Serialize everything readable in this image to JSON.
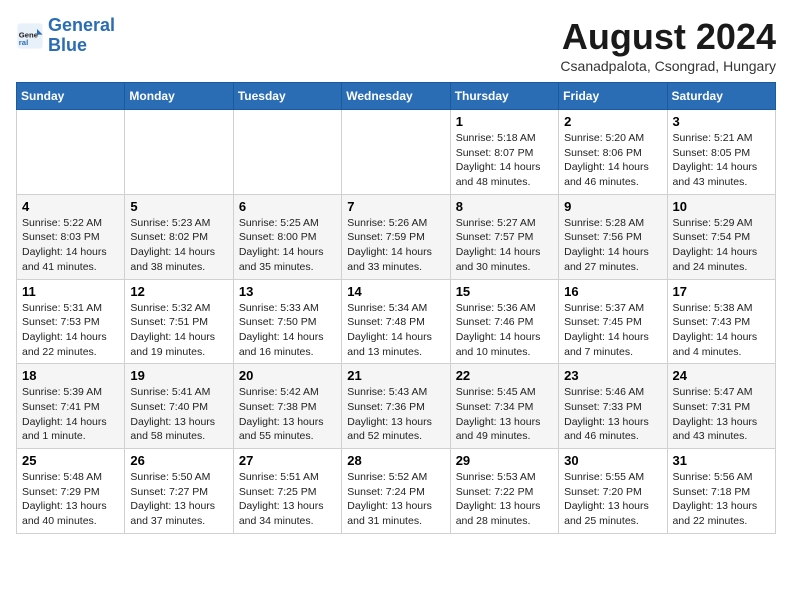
{
  "logo": {
    "line1": "General",
    "line2": "Blue"
  },
  "title": "August 2024",
  "subtitle": "Csanadpalota, Csongrad, Hungary",
  "days_of_week": [
    "Sunday",
    "Monday",
    "Tuesday",
    "Wednesday",
    "Thursday",
    "Friday",
    "Saturday"
  ],
  "weeks": [
    [
      {
        "day": "",
        "info": ""
      },
      {
        "day": "",
        "info": ""
      },
      {
        "day": "",
        "info": ""
      },
      {
        "day": "",
        "info": ""
      },
      {
        "day": "1",
        "info": "Sunrise: 5:18 AM\nSunset: 8:07 PM\nDaylight: 14 hours and 48 minutes."
      },
      {
        "day": "2",
        "info": "Sunrise: 5:20 AM\nSunset: 8:06 PM\nDaylight: 14 hours and 46 minutes."
      },
      {
        "day": "3",
        "info": "Sunrise: 5:21 AM\nSunset: 8:05 PM\nDaylight: 14 hours and 43 minutes."
      }
    ],
    [
      {
        "day": "4",
        "info": "Sunrise: 5:22 AM\nSunset: 8:03 PM\nDaylight: 14 hours and 41 minutes."
      },
      {
        "day": "5",
        "info": "Sunrise: 5:23 AM\nSunset: 8:02 PM\nDaylight: 14 hours and 38 minutes."
      },
      {
        "day": "6",
        "info": "Sunrise: 5:25 AM\nSunset: 8:00 PM\nDaylight: 14 hours and 35 minutes."
      },
      {
        "day": "7",
        "info": "Sunrise: 5:26 AM\nSunset: 7:59 PM\nDaylight: 14 hours and 33 minutes."
      },
      {
        "day": "8",
        "info": "Sunrise: 5:27 AM\nSunset: 7:57 PM\nDaylight: 14 hours and 30 minutes."
      },
      {
        "day": "9",
        "info": "Sunrise: 5:28 AM\nSunset: 7:56 PM\nDaylight: 14 hours and 27 minutes."
      },
      {
        "day": "10",
        "info": "Sunrise: 5:29 AM\nSunset: 7:54 PM\nDaylight: 14 hours and 24 minutes."
      }
    ],
    [
      {
        "day": "11",
        "info": "Sunrise: 5:31 AM\nSunset: 7:53 PM\nDaylight: 14 hours and 22 minutes."
      },
      {
        "day": "12",
        "info": "Sunrise: 5:32 AM\nSunset: 7:51 PM\nDaylight: 14 hours and 19 minutes."
      },
      {
        "day": "13",
        "info": "Sunrise: 5:33 AM\nSunset: 7:50 PM\nDaylight: 14 hours and 16 minutes."
      },
      {
        "day": "14",
        "info": "Sunrise: 5:34 AM\nSunset: 7:48 PM\nDaylight: 14 hours and 13 minutes."
      },
      {
        "day": "15",
        "info": "Sunrise: 5:36 AM\nSunset: 7:46 PM\nDaylight: 14 hours and 10 minutes."
      },
      {
        "day": "16",
        "info": "Sunrise: 5:37 AM\nSunset: 7:45 PM\nDaylight: 14 hours and 7 minutes."
      },
      {
        "day": "17",
        "info": "Sunrise: 5:38 AM\nSunset: 7:43 PM\nDaylight: 14 hours and 4 minutes."
      }
    ],
    [
      {
        "day": "18",
        "info": "Sunrise: 5:39 AM\nSunset: 7:41 PM\nDaylight: 14 hours and 1 minute."
      },
      {
        "day": "19",
        "info": "Sunrise: 5:41 AM\nSunset: 7:40 PM\nDaylight: 13 hours and 58 minutes."
      },
      {
        "day": "20",
        "info": "Sunrise: 5:42 AM\nSunset: 7:38 PM\nDaylight: 13 hours and 55 minutes."
      },
      {
        "day": "21",
        "info": "Sunrise: 5:43 AM\nSunset: 7:36 PM\nDaylight: 13 hours and 52 minutes."
      },
      {
        "day": "22",
        "info": "Sunrise: 5:45 AM\nSunset: 7:34 PM\nDaylight: 13 hours and 49 minutes."
      },
      {
        "day": "23",
        "info": "Sunrise: 5:46 AM\nSunset: 7:33 PM\nDaylight: 13 hours and 46 minutes."
      },
      {
        "day": "24",
        "info": "Sunrise: 5:47 AM\nSunset: 7:31 PM\nDaylight: 13 hours and 43 minutes."
      }
    ],
    [
      {
        "day": "25",
        "info": "Sunrise: 5:48 AM\nSunset: 7:29 PM\nDaylight: 13 hours and 40 minutes."
      },
      {
        "day": "26",
        "info": "Sunrise: 5:50 AM\nSunset: 7:27 PM\nDaylight: 13 hours and 37 minutes."
      },
      {
        "day": "27",
        "info": "Sunrise: 5:51 AM\nSunset: 7:25 PM\nDaylight: 13 hours and 34 minutes."
      },
      {
        "day": "28",
        "info": "Sunrise: 5:52 AM\nSunset: 7:24 PM\nDaylight: 13 hours and 31 minutes."
      },
      {
        "day": "29",
        "info": "Sunrise: 5:53 AM\nSunset: 7:22 PM\nDaylight: 13 hours and 28 minutes."
      },
      {
        "day": "30",
        "info": "Sunrise: 5:55 AM\nSunset: 7:20 PM\nDaylight: 13 hours and 25 minutes."
      },
      {
        "day": "31",
        "info": "Sunrise: 5:56 AM\nSunset: 7:18 PM\nDaylight: 13 hours and 22 minutes."
      }
    ]
  ]
}
